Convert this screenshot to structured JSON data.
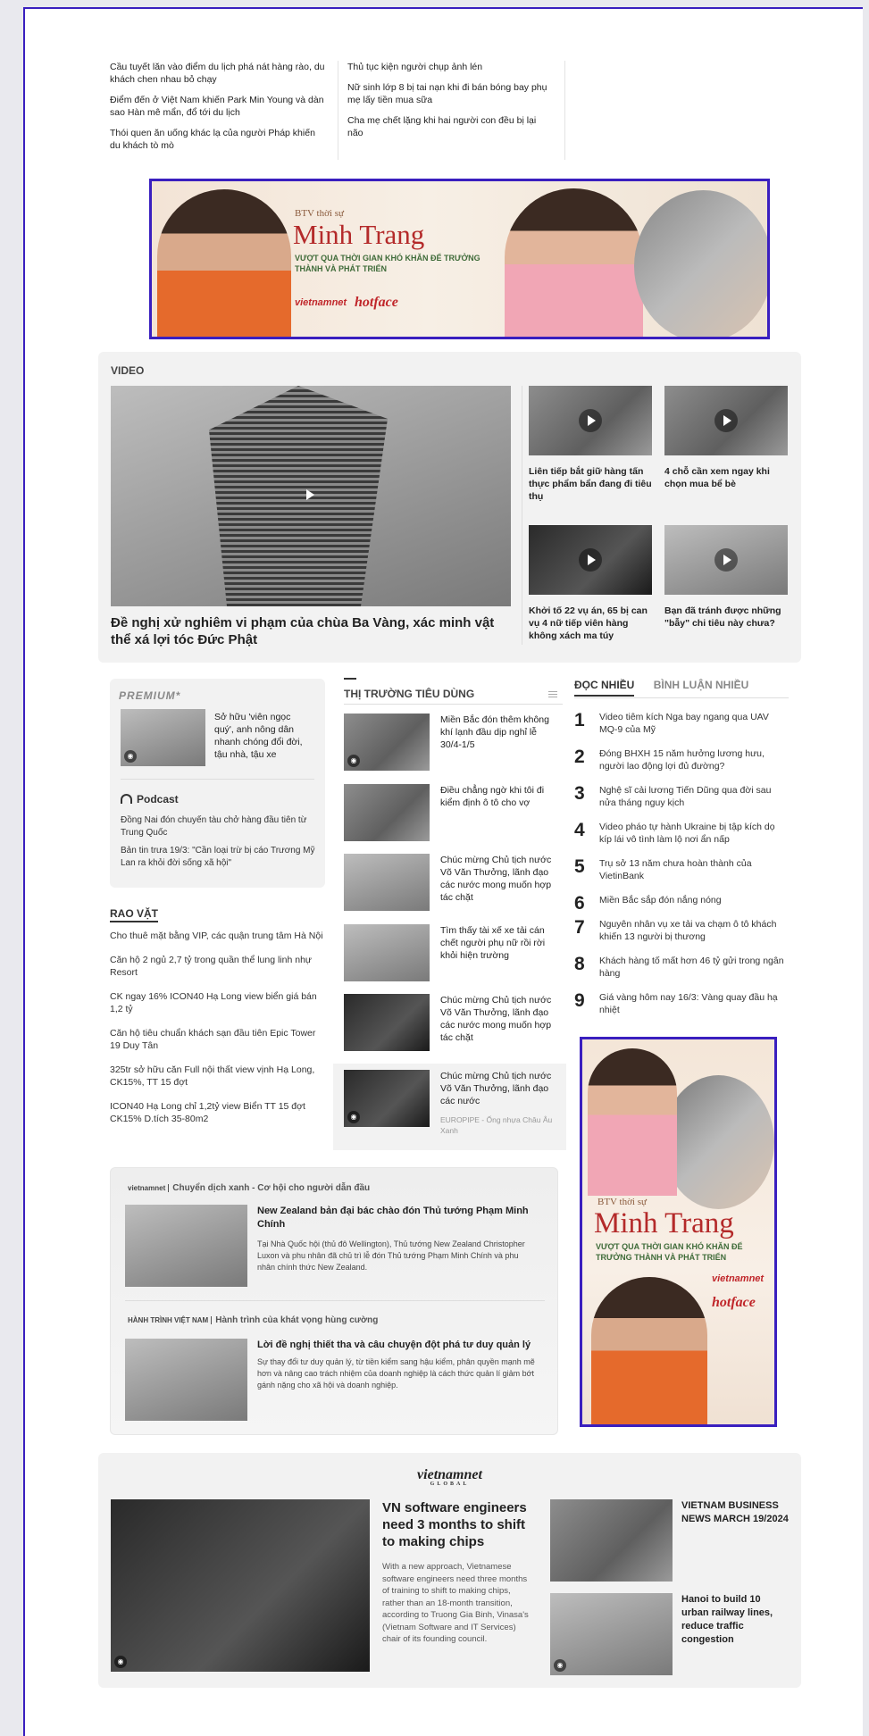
{
  "top_links": {
    "left": [
      "Cầu tuyết lăn vào điểm du lịch phá nát hàng rào, du khách chen nhau bỏ chạy",
      "Điểm đến ở Việt Nam khiến Park Min Young và dàn sao Hàn mê mẩn, đổ tới du lịch",
      "Thói quen ăn uống khác lạ của người Pháp khiến du khách tò mò"
    ],
    "right": [
      "Thủ tục kiện người chụp ảnh lén",
      "Nữ sinh lớp 8 bị tai nạn khi đi bán bóng bay phụ mẹ lấy tiền mua sữa",
      "Cha mẹ chết lặng khi hai người con đều bị lại não"
    ]
  },
  "banner": {
    "kicker": "BTV thời sự",
    "name": "Minh Trang",
    "sub": "VƯỢT QUA THỜI GIAN KHÓ KHĂN ĐỂ TRƯỞNG THÀNH VÀ PHÁT TRIỂN",
    "logo1": "vietnamnet",
    "logo2": "hotface"
  },
  "video": {
    "heading": "VIDEO",
    "main_title": "Đề nghị xử nghiêm vi phạm của chùa Ba Vàng, xác minh vật thể xá lợi tóc Đức Phật",
    "cards": [
      "Liên tiếp bắt giữ hàng tấn thực phẩm bẩn đang đi tiêu thụ",
      "4 chỗ cần xem ngay khi chọn mua bể bè",
      "Khởi tố 22 vụ án, 65 bị can vụ 4 nữ tiếp viên hàng không xách ma túy",
      "Bạn đã tránh được những \"bẫy\" chi tiêu này chưa?"
    ]
  },
  "premium": {
    "logo": "PREMIUM*",
    "story": "Sở hữu 'viên ngọc quý', anh nông dân nhanh chóng đổi đời, tậu nhà, tậu xe",
    "podcast_label": "Podcast",
    "podcast_items": [
      "Đồng Nai đón chuyến tàu chở hàng đầu tiên từ Trung Quốc",
      "Bản tin trưa 19/3: \"Cần loại trừ bị cáo Trương Mỹ Lan ra khỏi đời sống xã hội\""
    ]
  },
  "rao_vat": {
    "heading": "RAO VẶT",
    "items": [
      "Cho thuê mặt bằng VIP, các quận trung tâm Hà Nội",
      "Căn hộ 2 ngủ 2,7 tỷ trong quần thể lung linh nhự Resort",
      "CK ngay 16% ICON40 Hạ Long view biển giá bán 1,2 tỷ",
      "Căn hộ tiêu chuẩn khách sạn đầu tiên Epic Tower 19 Duy Tân",
      "325tr sở hữu căn Full nội thất view vịnh Hạ Long, CK15%, TT 15 đợt",
      "ICON40 Hạ Long chỉ 1,2tỷ view Biển TT 15 đợt CK15% D.tích 35-80m2"
    ]
  },
  "thi_truong": {
    "heading": "THỊ TRƯỜNG TIÊU DÙNG",
    "items": [
      "Miền Bắc đón thêm không khí lạnh đầu dịp nghỉ lễ 30/4-1/5",
      "Điều chẳng ngờ khi tôi đi kiểm định ô tô cho vợ",
      "Chúc mừng Chủ tịch nước Võ Văn Thưởng, lãnh đạo các nước mong muốn hợp tác chặt",
      "Tìm thấy tài xế xe tải cán chết người phụ nữ rồi rời khỏi hiện trường",
      "Chúc mừng Chủ tịch nước Võ Văn Thưởng, lãnh đạo các nước mong muốn hợp tác chặt",
      "Chúc mừng Chủ tịch nước Võ Văn Thưởng, lãnh đạo các nước"
    ],
    "sponsor": "EUROPIPE - Ống nhựa Châu Âu Xanh"
  },
  "doc_nhieu": {
    "tab_active": "ĐỌC NHIỀU",
    "tab_other": "BÌNH LUẬN NHIỀU",
    "items": [
      {
        "n": "1",
        "t": "Video tiêm kích Nga bay ngang qua UAV MQ-9 của Mỹ"
      },
      {
        "n": "2",
        "t": "Đóng BHXH 15 năm hưởng lương hưu, người lao động lợi đủ đường?"
      },
      {
        "n": "3",
        "t": "Nghệ sĩ cải lương Tiến Dũng qua đời sau nửa tháng nguy kịch"
      },
      {
        "n": "4",
        "t": "Video pháo tự hành Ukraine bị tập kích dọ kíp lái vô tình làm lộ nơi ẩn nấp"
      },
      {
        "n": "5",
        "t": "Trụ sở 13 năm chưa hoàn thành của VietinBank"
      },
      {
        "n": "6",
        "t": "Miền Bắc sắp đón nắng nóng"
      },
      {
        "n": "7",
        "t": "Nguyên nhân vụ xe tải va chạm ô tô khách khiến 13 người bị thương"
      },
      {
        "n": "8",
        "t": "Khách hàng tố mất hơn 46 tỷ gửi trong ngân hàng"
      },
      {
        "n": "9",
        "t": "Giá vàng hôm nay 16/3: Vàng quay đầu hạ nhiệt"
      }
    ]
  },
  "side_banner": {
    "kicker": "BTV thời sự",
    "name": "Minh Trang",
    "sub": "VƯỢT QUA THỜI GIAN KHÓ KHĂN ĐỂ TRƯỞNG THÀNH VÀ PHÁT TRIỂN",
    "logo1": "vietnamnet",
    "logo2": "hotface"
  },
  "partner": {
    "label1_logo": "vietnamnet",
    "label1": "Chuyển dịch xanh - Cơ hội cho người dẫn đầu",
    "story1_title": "New Zealand bản đại bác chào đón Thủ tướng Phạm Minh Chính",
    "story1_desc": "Tại Nhà Quốc hội (thủ đô Wellington), Thủ tướng New Zealand Christopher Luxon và phu nhân đã chủ trì lễ đón Thủ tướng Phạm Minh Chính và phu nhân chính thức New Zealand.",
    "label2_logo": "HÀNH TRÌNH VIỆT NAM",
    "label2": "Hành trình của khát vọng hùng cường",
    "story2_title": "Lời đề nghị thiết tha và câu chuyện đột phá tư duy quản lý",
    "story2_desc": "Sự thay đổi tư duy quản lý, từ tiền kiểm sang hậu kiểm, phân quyền mạnh mẽ hơn và nâng cao trách nhiệm của doanh nghiệp là cách thức quản lí giảm bớt gánh nặng cho xã hội và doanh nghiệp."
  },
  "global": {
    "logo": "vietnamnet",
    "logo_sub": "GLOBAL",
    "main_title": "VN software engineers need 3 months to shift to making chips",
    "main_desc": "With a new approach, Vietnamese software engineers need three months of training to shift to making chips, rather than an 18-month transition, according to Truong Gia Binh, Vinasa's (Vietnam Software and IT Services) chair of its founding council.",
    "cards": [
      "VIETNAM BUSINESS NEWS MARCH 19/2024",
      "Hanoi to build 10 urban railway lines, reduce traffic congestion"
    ]
  }
}
